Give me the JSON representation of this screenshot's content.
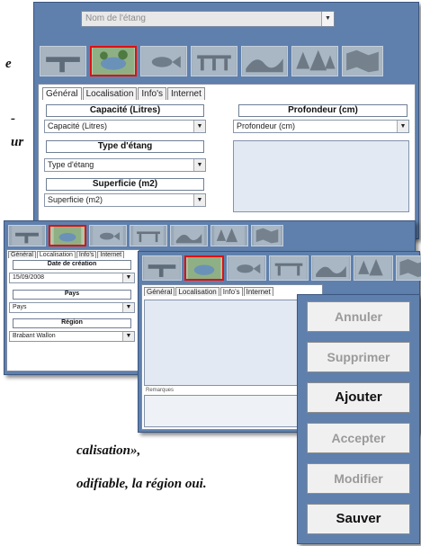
{
  "doc": {
    "line1": "e",
    "line2": "-",
    "line3": "ur",
    "line4": "",
    "line5": "calisation»,",
    "line6": "odifiable, la région oui."
  },
  "colors": {
    "window": "#5f80ad",
    "active_icon_border": "#e01010"
  },
  "main": {
    "pond_name_placeholder": "Nom de l'étang",
    "tabs": [
      "Général",
      "Localisation",
      "Info's",
      "Internet"
    ],
    "capacite": {
      "title": "Capacité (Litres)",
      "value": "Capacité (Litres)"
    },
    "type": {
      "title": "Type d'étang",
      "value": "Type d'étang"
    },
    "superficie": {
      "title": "Superficie (m2)",
      "value": "Superficie (m2)"
    },
    "profondeur": {
      "title": "Profondeur (cm)",
      "value": "Profondeur (cm)"
    },
    "icons": [
      "tool-icon",
      "pond-photo-icon",
      "fish-icon",
      "bridge-icon",
      "landscape-icon",
      "trees-icon",
      "map-icon"
    ]
  },
  "loc": {
    "tabs": [
      "Général",
      "Localisation",
      "Info's",
      "Internet"
    ],
    "date_title": "Date de création",
    "date_value": "15/09/2008",
    "pays_title": "Pays",
    "pays_value": "Pays",
    "region_title": "Région",
    "region_value": "Brabant Wallon"
  },
  "info": {
    "tabs": [
      "Général",
      "Localisation",
      "Info's",
      "Internet"
    ],
    "remarks_label": "Remarques"
  },
  "buttons": [
    {
      "label": "Annuler",
      "enabled": false
    },
    {
      "label": "Supprimer",
      "enabled": false
    },
    {
      "label": "Ajouter",
      "enabled": true
    },
    {
      "label": "Accepter",
      "enabled": false
    },
    {
      "label": "Modifier",
      "enabled": false
    },
    {
      "label": "Sauver",
      "enabled": true
    }
  ]
}
